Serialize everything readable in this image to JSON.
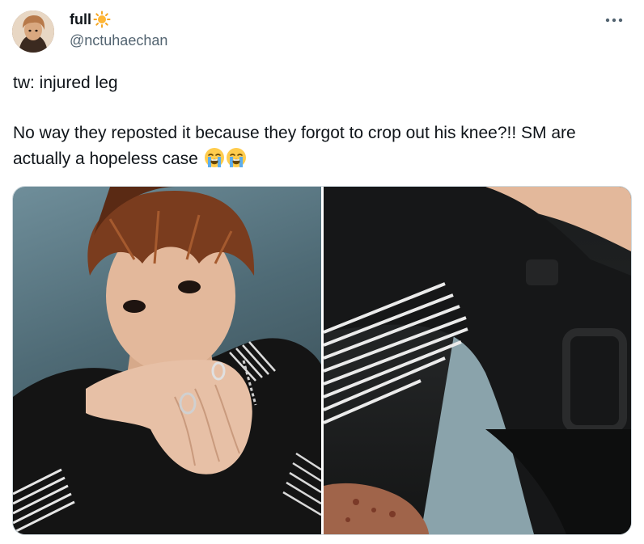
{
  "author": {
    "display_name": "full",
    "name_emoji": "sun-icon",
    "handle": "@nctuhaechan",
    "avatar": "avatar-photo"
  },
  "menu": {
    "icon": "more-horizontal-icon"
  },
  "tweet": {
    "line1": "tw: injured leg",
    "line2": "No way they reposted it because they forgot to crop out his knee?!! SM are actually a hopeless case",
    "trailing_emojis": [
      "loudly-crying-face-emoji",
      "loudly-crying-face-emoji"
    ]
  },
  "media": {
    "photos": [
      {
        "name": "photo-portrait",
        "description_icon": "photo"
      },
      {
        "name": "photo-knee-crop",
        "description_icon": "photo"
      }
    ]
  },
  "colors": {
    "text_primary": "#0f1419",
    "text_secondary": "#536471",
    "border": "#cfd9de"
  }
}
